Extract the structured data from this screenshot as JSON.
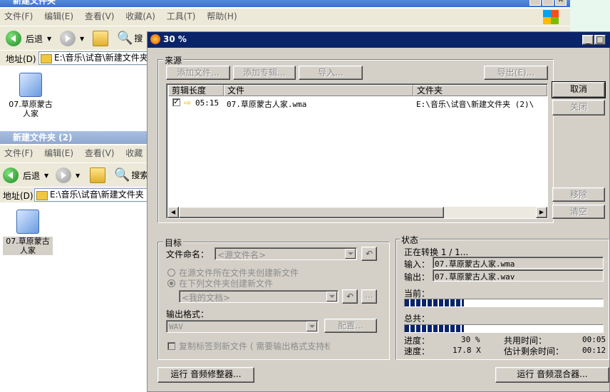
{
  "explorer1": {
    "title": "新建文件夹",
    "menu": [
      "文件(F)",
      "编辑(E)",
      "查看(V)",
      "收藏(A)",
      "工具(T)",
      "帮助(H)"
    ],
    "back": "后退",
    "search": "搜",
    "address_label": "地址(D)",
    "address": "E:\\音乐\\试音\\新建文件夹",
    "file": "07.草原蒙古人家"
  },
  "explorer2": {
    "title": "新建文件夹 (2)",
    "menu": [
      "文件(F)",
      "编辑(E)",
      "查看(V)",
      "收藏"
    ],
    "back": "后退",
    "search": "搜索",
    "address_label": "地址(D)",
    "address": "E:\\音乐\\试音\\新建文件夹 (",
    "file": "07.草原蒙古人家"
  },
  "dialog": {
    "title": "30 %",
    "source": {
      "label": "来源",
      "add_files": "添加文件...",
      "add_album": "添加专辑...",
      "import": "导入...",
      "export": "导出(E)...",
      "columns": [
        "剪辑长度",
        "文件",
        "文件夹"
      ],
      "rows": [
        {
          "length": "05:15",
          "file": "07.草原蒙古人家.wma",
          "folder": "E:\\音乐\\试音\\新建文件夹 (2)\\"
        }
      ]
    },
    "buttons": {
      "cancel": "取消",
      "close": "关闭",
      "remove": "移除",
      "clear": "清空"
    },
    "target": {
      "label": "目标",
      "naming_label": "文件命名：",
      "naming_value": "<源文件名>",
      "radio1": "在源文件所在文件夹创建新文件",
      "radio2": "在下列文件夹创建新文件",
      "folder_value": "<我的文档>",
      "format_label": "输出格式：",
      "format_value": "WAV",
      "config": "配置...",
      "copy_tags": "复制标签到新文件 ( 需要输出格式支持标"
    },
    "status": {
      "label": "状态",
      "converting": "正在转换 1 / 1...",
      "input_label": "输入：",
      "input_value": "07.草原蒙古人家.wma",
      "output_label": "输出：",
      "output_value": "07.草原蒙古人家.wav",
      "current_label": "当前：",
      "current_progress": 0.3,
      "total_label": "总共：",
      "total_progress": 0.3,
      "progress_label": "进度：",
      "progress_value": "30 %",
      "speed_label": "速度：",
      "speed_value": "17.8 X",
      "elapsed_label": "共用时间：",
      "elapsed_value": "00:05",
      "remaining_label": "估计剩余时间：",
      "remaining_value": "00:12"
    },
    "run_editor": "运行 音频修整器...",
    "run_mixer": "运行 音频混合器..."
  }
}
